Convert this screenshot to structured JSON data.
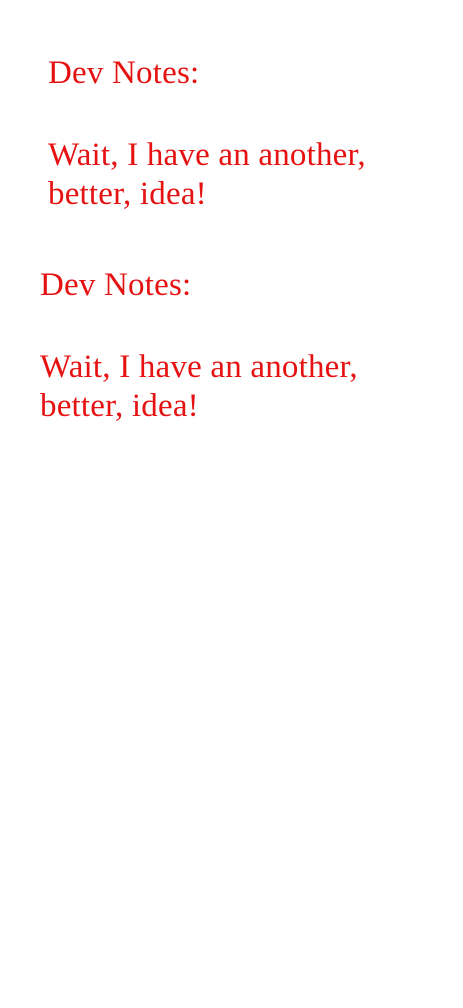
{
  "notes": [
    {
      "heading": "Dev Notes:",
      "message": "Wait, I have an another, better, idea!"
    },
    {
      "heading": "Dev Notes:",
      "message": "Wait, I have an another, better, idea!"
    }
  ],
  "colors": {
    "text": "#e61111",
    "background": "#ffffff"
  }
}
